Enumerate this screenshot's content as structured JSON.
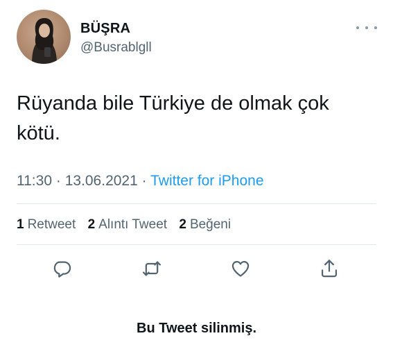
{
  "author": {
    "display_name": "BÜŞRA",
    "handle": "@Busrablgll",
    "avatar_icon": "profile-photo"
  },
  "tweet": {
    "text_line1": "Rüyanda bile Türkiye de olmak çok",
    "text_line2": "kötü.",
    "time": "11:30",
    "separator": "·",
    "date": "13.06.2021",
    "source": "Twitter for iPhone"
  },
  "stats": {
    "retweets_count": "1",
    "retweets_label": "Retweet",
    "quotes_count": "2",
    "quotes_label": "Alıntı Tweet",
    "likes_count": "2",
    "likes_label": "Beğeni"
  },
  "actions": [
    "reply-icon",
    "retweet-icon",
    "like-icon",
    "share-icon"
  ],
  "notice": "Bu Tweet silinmiş.",
  "colors": {
    "text": "#0f1419",
    "secondary": "#536471",
    "link": "#1d9bf0",
    "divider": "#e1e6ea"
  }
}
